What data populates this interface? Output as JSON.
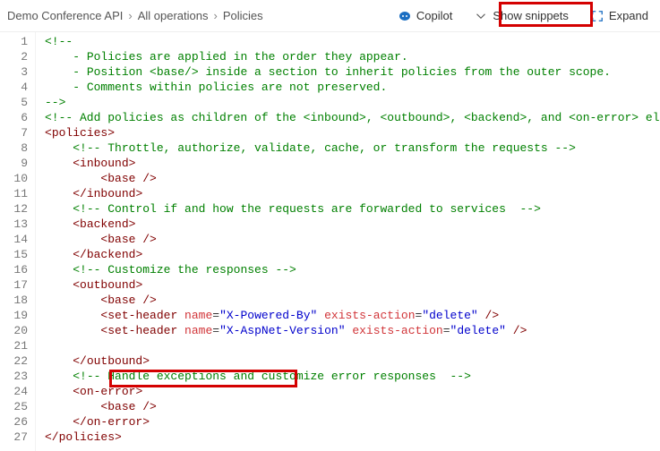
{
  "breadcrumb": {
    "api": "Demo Conference API",
    "operations": "All operations",
    "policies": "Policies"
  },
  "toolbar": {
    "copilot": "Copilot",
    "show_snippets": "Show snippets",
    "expand": "Expand"
  },
  "code": {
    "line_numbers": [
      "1",
      "2",
      "3",
      "4",
      "5",
      "6",
      "7",
      "8",
      "9",
      "10",
      "11",
      "12",
      "13",
      "14",
      "15",
      "16",
      "17",
      "18",
      "19",
      "20",
      "21",
      "22",
      "23",
      "24",
      "25",
      "26",
      "27"
    ],
    "lines": [
      {
        "indent": 0,
        "parts": [
          {
            "t": "<!--",
            "c": "c-comment"
          }
        ]
      },
      {
        "indent": 1,
        "parts": [
          {
            "t": "- Policies are applied in the order they appear.",
            "c": "c-comment"
          }
        ]
      },
      {
        "indent": 1,
        "parts": [
          {
            "t": "- Position <base/> inside a section to inherit policies from the outer scope.",
            "c": "c-comment"
          }
        ]
      },
      {
        "indent": 1,
        "parts": [
          {
            "t": "- Comments within policies are not preserved.",
            "c": "c-comment"
          }
        ]
      },
      {
        "indent": 0,
        "parts": [
          {
            "t": "-->",
            "c": "c-comment"
          }
        ]
      },
      {
        "indent": 0,
        "parts": [
          {
            "t": "<!-- Add policies as children of the <inbound>, <outbound>, <backend>, and <on-error> ele",
            "c": "c-comment"
          }
        ]
      },
      {
        "indent": 0,
        "parts": [
          {
            "t": "<",
            "c": "c-tag"
          },
          {
            "t": "policies",
            "c": "c-tag"
          },
          {
            "t": ">",
            "c": "c-tag"
          }
        ]
      },
      {
        "indent": 1,
        "parts": [
          {
            "t": "<!-- Throttle, authorize, validate, cache, or transform the requests -->",
            "c": "c-comment"
          }
        ]
      },
      {
        "indent": 1,
        "parts": [
          {
            "t": "<",
            "c": "c-tag"
          },
          {
            "t": "inbound",
            "c": "c-tag"
          },
          {
            "t": ">",
            "c": "c-tag"
          }
        ]
      },
      {
        "indent": 2,
        "parts": [
          {
            "t": "<",
            "c": "c-tag"
          },
          {
            "t": "base",
            "c": "c-tag"
          },
          {
            "t": " />",
            "c": "c-tag"
          }
        ]
      },
      {
        "indent": 1,
        "parts": [
          {
            "t": "</",
            "c": "c-tag"
          },
          {
            "t": "inbound",
            "c": "c-tag"
          },
          {
            "t": ">",
            "c": "c-tag"
          }
        ]
      },
      {
        "indent": 1,
        "parts": [
          {
            "t": "<!-- Control if and how the requests are forwarded to services  -->",
            "c": "c-comment"
          }
        ]
      },
      {
        "indent": 1,
        "parts": [
          {
            "t": "<",
            "c": "c-tag"
          },
          {
            "t": "backend",
            "c": "c-tag"
          },
          {
            "t": ">",
            "c": "c-tag"
          }
        ]
      },
      {
        "indent": 2,
        "parts": [
          {
            "t": "<",
            "c": "c-tag"
          },
          {
            "t": "base",
            "c": "c-tag"
          },
          {
            "t": " />",
            "c": "c-tag"
          }
        ]
      },
      {
        "indent": 1,
        "parts": [
          {
            "t": "</",
            "c": "c-tag"
          },
          {
            "t": "backend",
            "c": "c-tag"
          },
          {
            "t": ">",
            "c": "c-tag"
          }
        ]
      },
      {
        "indent": 1,
        "parts": [
          {
            "t": "<!-- Customize the responses -->",
            "c": "c-comment"
          }
        ]
      },
      {
        "indent": 1,
        "parts": [
          {
            "t": "<",
            "c": "c-tag"
          },
          {
            "t": "outbound",
            "c": "c-tag"
          },
          {
            "t": ">",
            "c": "c-tag"
          }
        ]
      },
      {
        "indent": 2,
        "parts": [
          {
            "t": "<",
            "c": "c-tag"
          },
          {
            "t": "base",
            "c": "c-tag"
          },
          {
            "t": " />",
            "c": "c-tag"
          }
        ]
      },
      {
        "indent": 2,
        "parts": [
          {
            "t": "<",
            "c": "c-tag"
          },
          {
            "t": "set-header",
            "c": "c-tag"
          },
          {
            "t": " name",
            "c": "c-attr"
          },
          {
            "t": "=",
            "c": ""
          },
          {
            "t": "\"X-Powered-By\"",
            "c": "c-str"
          },
          {
            "t": " exists-action",
            "c": "c-attr"
          },
          {
            "t": "=",
            "c": ""
          },
          {
            "t": "\"delete\"",
            "c": "c-str"
          },
          {
            "t": " />",
            "c": "c-tag"
          }
        ]
      },
      {
        "indent": 2,
        "parts": [
          {
            "t": "<",
            "c": "c-tag"
          },
          {
            "t": "set-header",
            "c": "c-tag"
          },
          {
            "t": " name",
            "c": "c-attr"
          },
          {
            "t": "=",
            "c": ""
          },
          {
            "t": "\"X-AspNet-Version\"",
            "c": "c-str"
          },
          {
            "t": " exists-action",
            "c": "c-attr"
          },
          {
            "t": "=",
            "c": ""
          },
          {
            "t": "\"delete\"",
            "c": "c-str"
          },
          {
            "t": " />",
            "c": "c-tag"
          }
        ]
      },
      {
        "indent": 0,
        "parts": []
      },
      {
        "indent": 1,
        "parts": [
          {
            "t": "</",
            "c": "c-tag"
          },
          {
            "t": "outbound",
            "c": "c-tag"
          },
          {
            "t": ">",
            "c": "c-tag"
          }
        ]
      },
      {
        "indent": 1,
        "parts": [
          {
            "t": "<!-- Handle exceptions and customize error responses  -->",
            "c": "c-comment"
          }
        ]
      },
      {
        "indent": 1,
        "parts": [
          {
            "t": "<",
            "c": "c-tag"
          },
          {
            "t": "on-error",
            "c": "c-tag"
          },
          {
            "t": ">",
            "c": "c-tag"
          }
        ]
      },
      {
        "indent": 2,
        "parts": [
          {
            "t": "<",
            "c": "c-tag"
          },
          {
            "t": "base",
            "c": "c-tag"
          },
          {
            "t": " />",
            "c": "c-tag"
          }
        ]
      },
      {
        "indent": 1,
        "parts": [
          {
            "t": "</",
            "c": "c-tag"
          },
          {
            "t": "on-error",
            "c": "c-tag"
          },
          {
            "t": ">",
            "c": "c-tag"
          }
        ]
      },
      {
        "indent": 0,
        "parts": [
          {
            "t": "</",
            "c": "c-tag"
          },
          {
            "t": "policies",
            "c": "c-tag"
          },
          {
            "t": ">",
            "c": "c-tag"
          }
        ]
      }
    ]
  }
}
